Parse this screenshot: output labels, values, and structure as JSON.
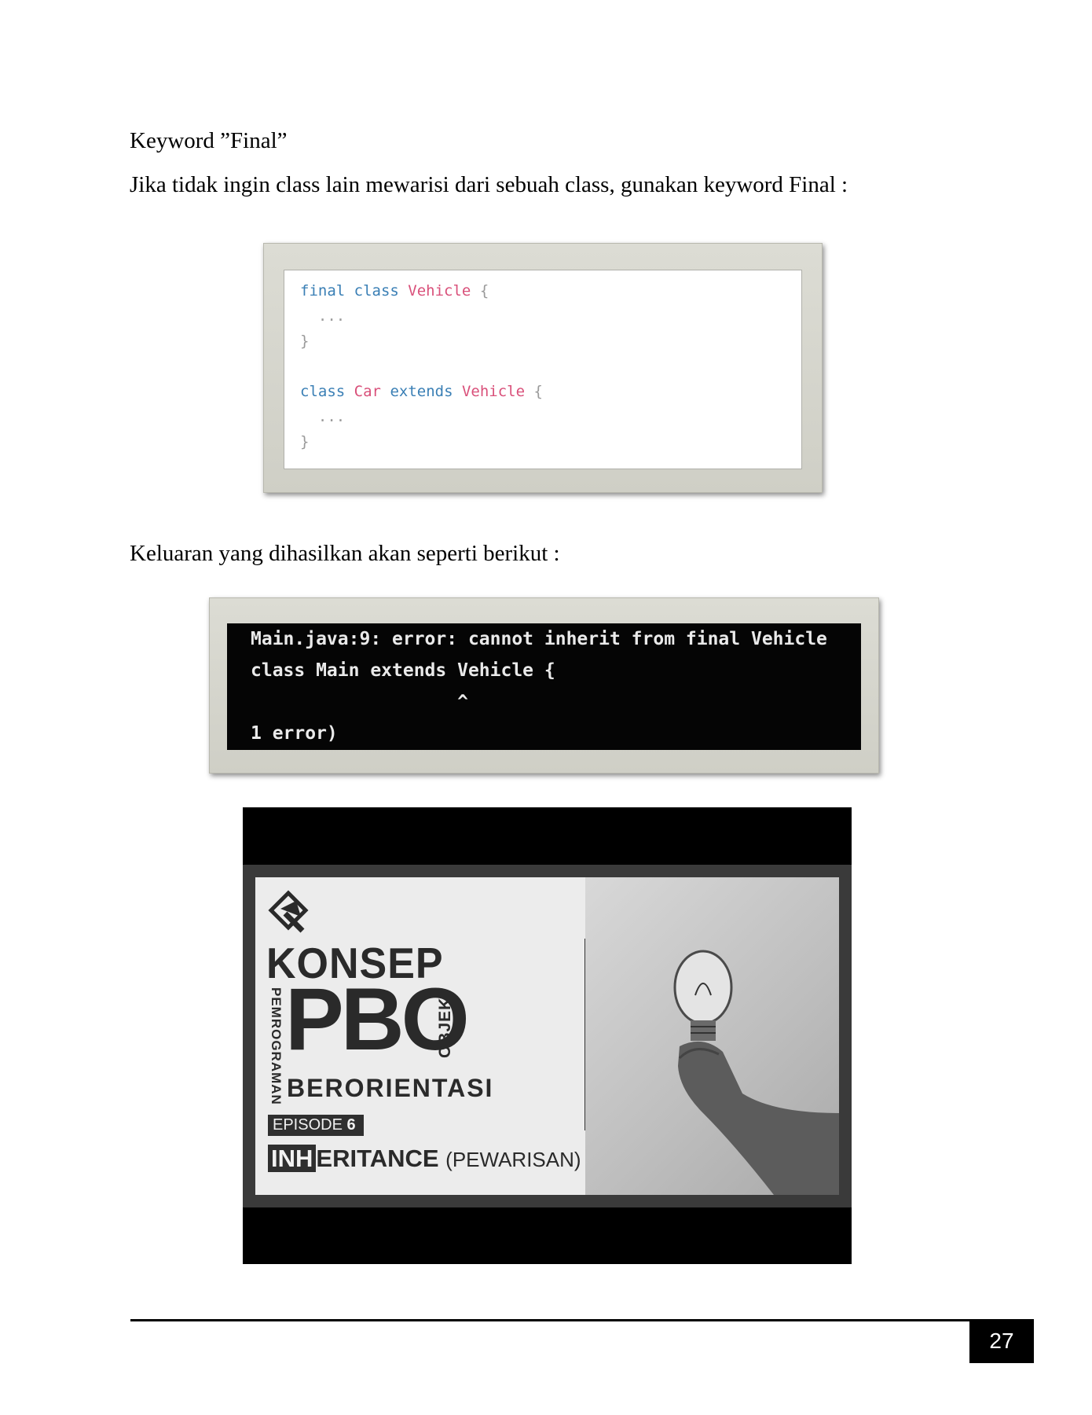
{
  "heading": "Keyword ”Final”",
  "intro": "Jika tidak ingin class lain mewarisi dari sebuah class, gunakan keyword Final :",
  "code": {
    "line1_kw": "final class",
    "line1_name": "Vehicle",
    "line1_brace": "{",
    "line2": "...",
    "line3": "}",
    "line5_kw1": "class",
    "line5_name1": "Car",
    "line5_kw2": "extends",
    "line5_name2": "Vehicle",
    "line5_brace": "{",
    "line6": "...",
    "line7": "}"
  },
  "outro": "Keluaran yang dihasilkan akan seperti berikut :",
  "terminal": {
    "line1": "Main.java:9: error: cannot inherit from final Vehicle",
    "line2": "class Main extends Vehicle {",
    "line3": "                   ^",
    "line4": "1 error)"
  },
  "thumbnail": {
    "konsep": "KONSEP",
    "pbo": "PBO",
    "pemrograman": "PEMROGRAMAN",
    "objek": "OBJEK",
    "berorientasi": "BERORIENTASI",
    "episode_label": "EPISODE",
    "episode_number": "6",
    "inherit_highlight": "INH",
    "inherit_rest": "ERITANCE",
    "inherit_paren": "(PEWARISAN)"
  },
  "page_number": "27"
}
